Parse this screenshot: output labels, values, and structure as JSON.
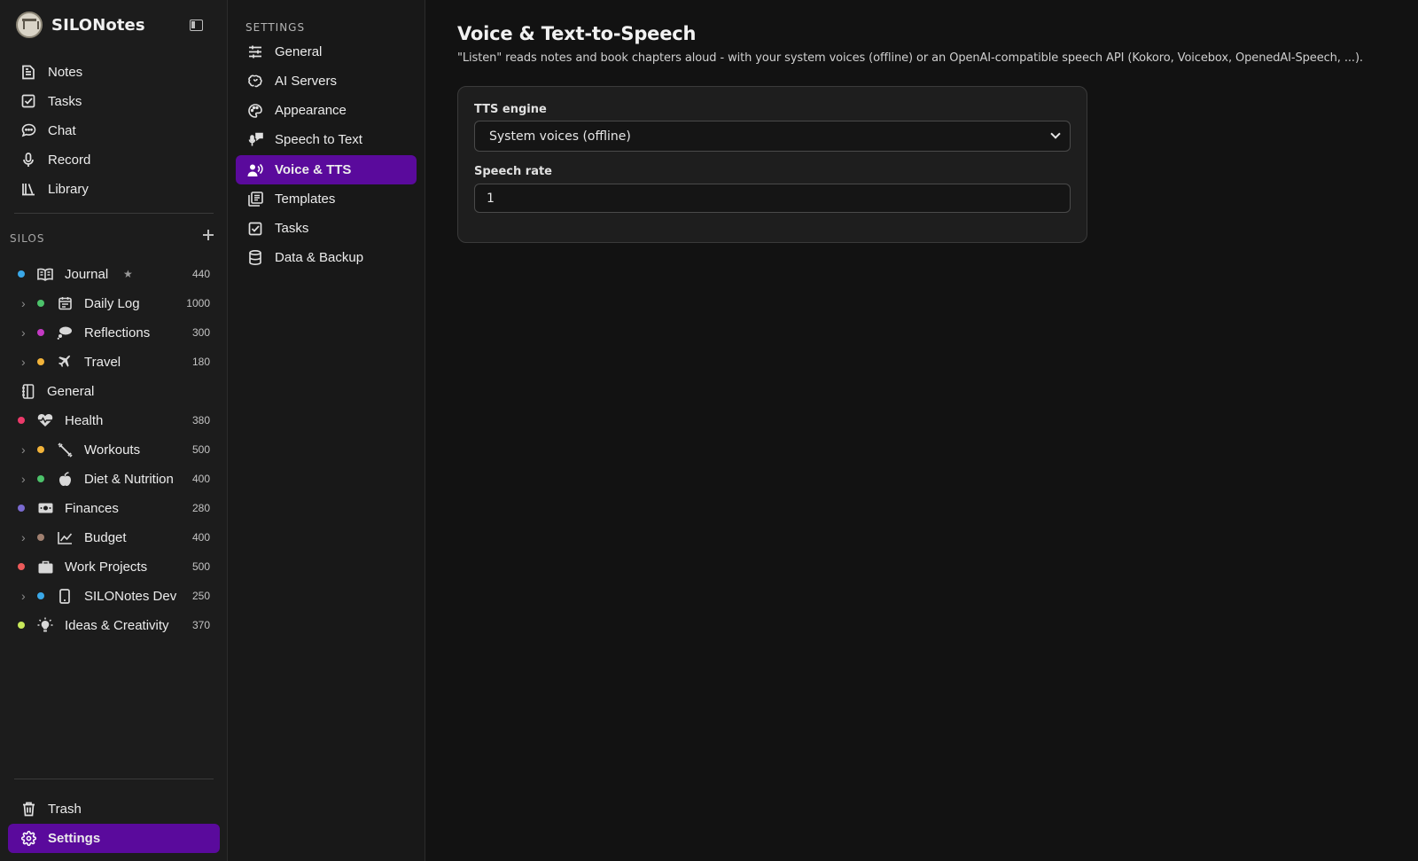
{
  "app": {
    "name": "SILONotes"
  },
  "nav": {
    "items": [
      {
        "label": "Notes",
        "icon": "note-icon"
      },
      {
        "label": "Tasks",
        "icon": "checkbox-icon"
      },
      {
        "label": "Chat",
        "icon": "chat-icon"
      },
      {
        "label": "Record",
        "icon": "microphone-icon"
      },
      {
        "label": "Library",
        "icon": "library-icon"
      }
    ]
  },
  "silos": {
    "title": "SILOS",
    "items": [
      {
        "name": "Journal",
        "count": "440",
        "level": 0,
        "dot": "#3aa8e8",
        "icon": "book-open-icon",
        "starred": true
      },
      {
        "name": "Daily Log",
        "count": "1000",
        "level": 1,
        "dot": "#4cc26a",
        "icon": "calendar-icon"
      },
      {
        "name": "Reflections",
        "count": "300",
        "level": 1,
        "dot": "#c43ac4",
        "icon": "thought-bubble-icon"
      },
      {
        "name": "Travel",
        "count": "180",
        "level": 1,
        "dot": "#f2b33a",
        "icon": "airplane-icon"
      },
      {
        "name": "General",
        "count": "",
        "level": -1,
        "dot": "",
        "icon": "notebook-icon"
      },
      {
        "name": "Health",
        "count": "380",
        "level": 0,
        "dot": "#ec3a6a",
        "icon": "heartbeat-icon"
      },
      {
        "name": "Workouts",
        "count": "500",
        "level": 1,
        "dot": "#f2b33a",
        "icon": "dumbbell-icon"
      },
      {
        "name": "Diet & Nutrition",
        "count": "400",
        "level": 1,
        "dot": "#4cc26a",
        "icon": "apple-icon"
      },
      {
        "name": "Finances",
        "count": "280",
        "level": 0,
        "dot": "#7a6ad0",
        "icon": "money-icon"
      },
      {
        "name": "Budget",
        "count": "400",
        "level": 1,
        "dot": "#a08070",
        "icon": "chart-line-icon"
      },
      {
        "name": "Work Projects",
        "count": "500",
        "level": 0,
        "dot": "#ec5a5a",
        "icon": "briefcase-icon"
      },
      {
        "name": "SILONotes Dev",
        "count": "250",
        "level": 1,
        "dot": "#3aa8e8",
        "icon": "phone-icon"
      },
      {
        "name": "Ideas & Creativity",
        "count": "370",
        "level": 0,
        "dot": "#c8e85a",
        "icon": "lightbulb-icon"
      }
    ]
  },
  "bottom": {
    "trash": "Trash",
    "settings": "Settings"
  },
  "settings_nav": {
    "title": "SETTINGS",
    "items": [
      {
        "label": "General",
        "icon": "sliders-icon"
      },
      {
        "label": "AI Servers",
        "icon": "brain-icon"
      },
      {
        "label": "Appearance",
        "icon": "palette-icon"
      },
      {
        "label": "Speech to Text",
        "icon": "speech-to-text-icon"
      },
      {
        "label": "Voice & TTS",
        "icon": "voice-icon",
        "active": true
      },
      {
        "label": "Templates",
        "icon": "templates-icon"
      },
      {
        "label": "Tasks",
        "icon": "checkbox-icon"
      },
      {
        "label": "Data & Backup",
        "icon": "database-icon"
      }
    ]
  },
  "main": {
    "title": "Voice & Text-to-Speech",
    "description": "\"Listen\" reads notes and book chapters aloud - with your system voices (offline) or an OpenAI-compatible speech API (Kokoro, Voicebox, OpenedAI-Speech, ...).",
    "tts_engine_label": "TTS engine",
    "tts_engine_value": "System voices (offline)",
    "speech_rate_label": "Speech rate",
    "speech_rate_value": "1"
  },
  "colors": {
    "accent": "#5a0a9c",
    "background": "#121212",
    "sidebar": "#1c1c1c"
  }
}
